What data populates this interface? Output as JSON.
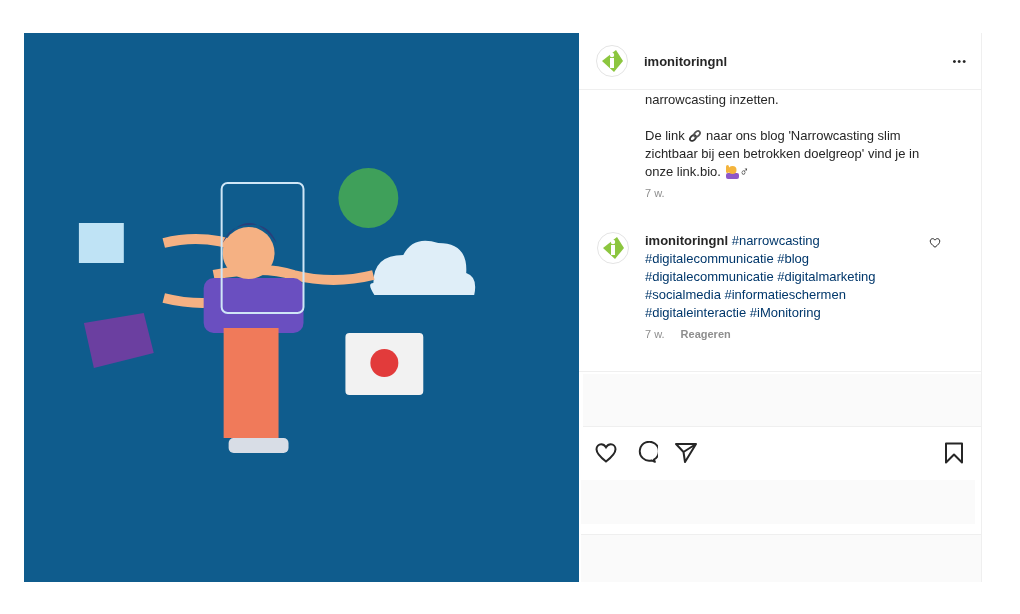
{
  "post": {
    "header": {
      "username": "imonitoringnl",
      "more": "•••"
    },
    "caption": {
      "first": "narrowcasting inzetten.",
      "before": "De link",
      "after": "naar ons blog 'Narrowcasting slim zichtbaar bij een betrokken doelgreop' vind je in onze link.bio.",
      "suffix": "♂",
      "time": "7 w."
    },
    "comment": {
      "username": "imonitoringnl",
      "hashtags": [
        "#narrowcasting",
        "#digitalecommunicatie",
        "#blog",
        "#digitalecommunicatie",
        "#digitalmarketing",
        "#socialmedia",
        "#informatieschermen",
        "#digitaleinteractie",
        "#iMonitoring"
      ],
      "time": "7 w.",
      "reply": "Reageren",
      "liked": false
    },
    "actions": {
      "liked": false,
      "saved": false
    }
  }
}
